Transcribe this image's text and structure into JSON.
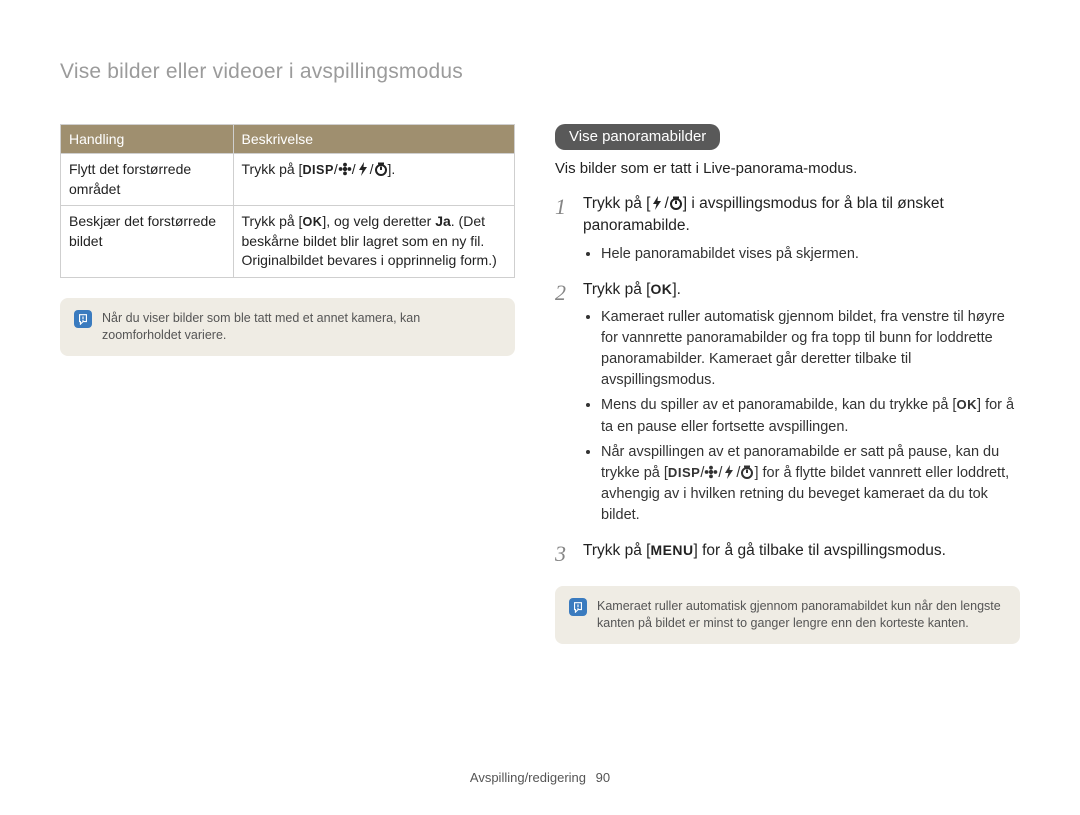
{
  "page_title": "Vise bilder eller videoer i avspillingsmodus",
  "table": {
    "headers": [
      "Handling",
      "Beskrivelse"
    ],
    "rows": [
      {
        "action": "Flytt det forstørrede området",
        "desc_pre": "Trykk på [",
        "desc_post": "]."
      },
      {
        "action": "Beskjær det forstørrede bildet",
        "desc_pre": "Trykk på [",
        "desc_mid": "], og velg deretter ",
        "ja": "Ja",
        "desc_post": ". (Det beskårne bildet blir lagret som en ny fil. Originalbildet bevares i opprinnelig form.)"
      }
    ]
  },
  "note_left": "Når du viser bilder som ble tatt med et annet kamera, kan zoomforholdet variere.",
  "section_badge": "Vise panoramabilder",
  "section_intro": "Vis bilder som er tatt i Live-panorama-modus.",
  "steps": [
    {
      "pre": "Trykk på [",
      "mid": "] i avspillingsmodus for å bla til ønsket panoramabilde.",
      "sub": [
        "Hele panoramabildet vises på skjermen."
      ]
    },
    {
      "pre": "Trykk på [",
      "post": "].",
      "sub": [
        "Kameraet ruller automatisk gjennom bildet, fra venstre til høyre for vannrette panoramabilder og fra topp til bunn for loddrette panoramabilder. Kameraet går deretter tilbake til avspillingsmodus.",
        "Mens du spiller av et panoramabilde, kan du trykke på [__OK__] for å ta en pause eller fortsette avspillingen.",
        "Når avspillingen av et panoramabilde er satt på pause, kan du trykke på [__DISP4__] for å flytte bildet vannrett eller loddrett, avhengig av i hvilken retning du beveget kameraet da du tok bildet."
      ]
    },
    {
      "pre": "Trykk på [",
      "post": "] for å gå tilbake til avspillingsmodus."
    }
  ],
  "note_right": "Kameraet ruller automatisk gjennom panoramabildet kun når den lengste kanten på bildet er minst to ganger lengre enn den korteste kanten.",
  "labels": {
    "ok": "OK",
    "disp": "DISP",
    "menu": "MENU"
  },
  "footer": {
    "section": "Avspilling/redigering",
    "page": "90"
  }
}
